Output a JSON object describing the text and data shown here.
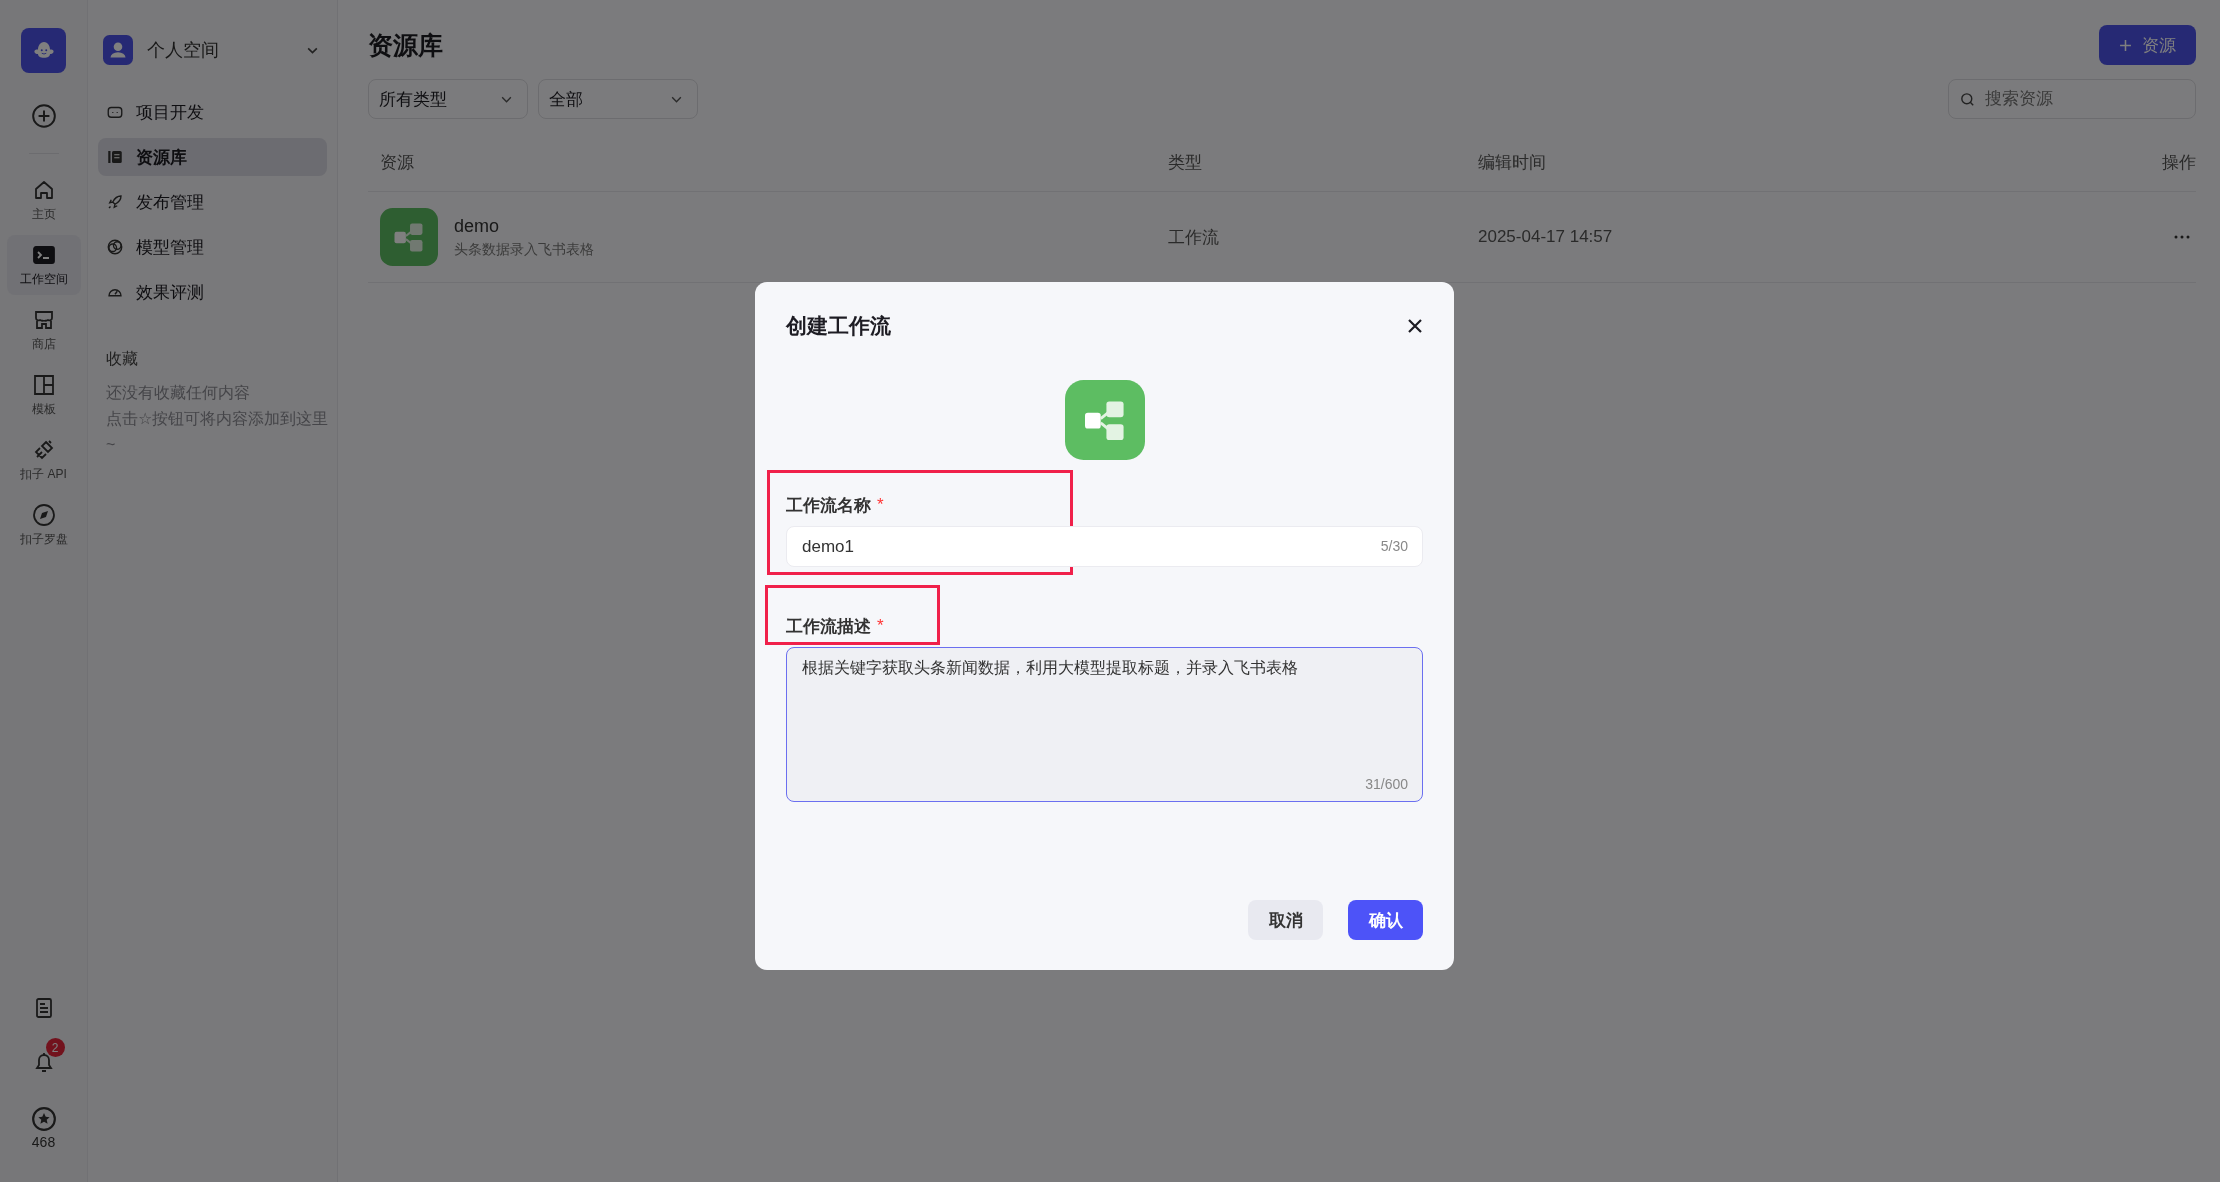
{
  "rail": {
    "items": [
      {
        "label": "主页",
        "selected": false
      },
      {
        "label": "工作空间",
        "selected": true
      },
      {
        "label": "商店",
        "selected": false
      },
      {
        "label": "模板",
        "selected": false
      },
      {
        "label": "扣子 API",
        "selected": false
      },
      {
        "label": "扣子罗盘",
        "selected": false
      }
    ],
    "notifications_badge": "2",
    "points": "468"
  },
  "sidebar": {
    "space": "个人空间",
    "items": [
      {
        "label": "项目开发",
        "selected": false
      },
      {
        "label": "资源库",
        "selected": true
      },
      {
        "label": "发布管理",
        "selected": false
      },
      {
        "label": "模型管理",
        "selected": false
      },
      {
        "label": "效果评测",
        "selected": false
      }
    ],
    "favorites": {
      "title": "收藏",
      "empty_lines": [
        "还没有收藏任何内容",
        "点击☆按钮可将内容添加到这里~"
      ]
    }
  },
  "main": {
    "title": "资源库",
    "add_button": "资源",
    "filters": [
      "所有类型",
      "全部"
    ],
    "search": {
      "placeholder": "搜索资源"
    },
    "table": {
      "columns": [
        "资源",
        "类型",
        "编辑时间",
        "操作"
      ],
      "rows": [
        {
          "name": "demo",
          "description": "头条数据录入飞书表格",
          "type": "工作流",
          "edited": "2025-04-17 14:57"
        }
      ]
    }
  },
  "dialog": {
    "title": "创建工作流",
    "fields": [
      {
        "kind": "input",
        "label": "工作流名称",
        "required_mark": "*",
        "value": "demo1",
        "counter": "5/30"
      },
      {
        "kind": "textarea",
        "label": "工作流描述",
        "required_mark": "*",
        "value": "根据关键字获取头条新闻数据，利用大模型提取标题，并录入飞书表格",
        "counter": "31/600"
      }
    ],
    "cancel": "取消",
    "confirm": "确认"
  }
}
